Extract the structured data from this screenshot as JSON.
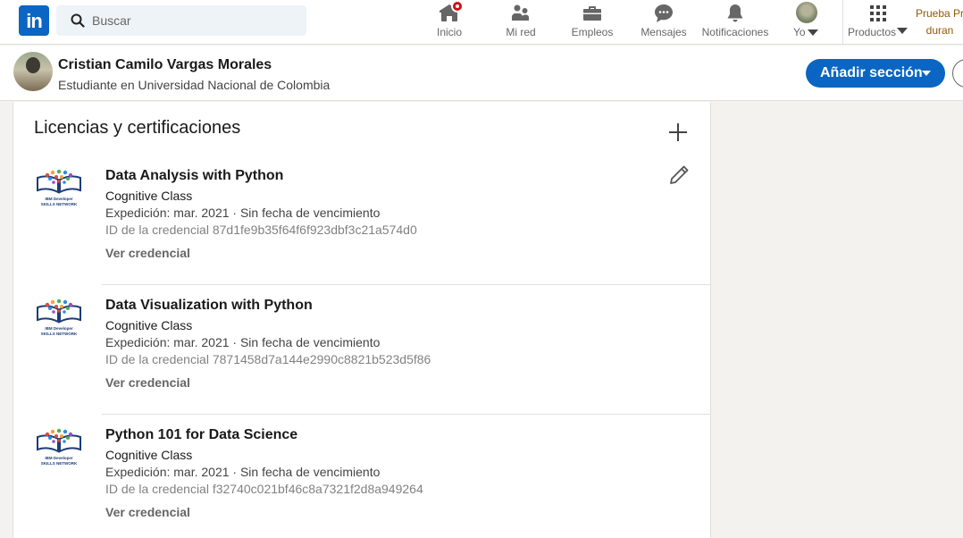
{
  "nav": {
    "logo": "in",
    "search_placeholder": "Buscar",
    "items": [
      {
        "label": "Inicio",
        "icon": "home-icon"
      },
      {
        "label": "Mi red",
        "icon": "network-icon"
      },
      {
        "label": "Empleos",
        "icon": "briefcase-icon"
      },
      {
        "label": "Mensajes",
        "icon": "messaging-icon"
      },
      {
        "label": "Notificaciones",
        "icon": "bell-icon"
      },
      {
        "label": "Yo",
        "icon": "avatar"
      },
      {
        "label": "Productos",
        "icon": "grid-icon"
      }
    ],
    "premium_line1": "Prueba Pr",
    "premium_line2": "duran"
  },
  "profile": {
    "name": "Cristian Camilo Vargas Morales",
    "headline": "Estudiante en Universidad Nacional de Colombia",
    "add_section_label": "Añadir sección"
  },
  "section": {
    "title": "Licencias y certificaciones",
    "certs": [
      {
        "title": "Data Analysis with Python",
        "issuer": "Cognitive Class",
        "date": "Expedición: mar. 2021 · Sin fecha de vencimiento",
        "credential_id": "ID de la credencial 87d1fe9b35f64f6f923dbf3c21a574d0",
        "link": "Ver credencial",
        "logo_text_1": "IBM Developer",
        "logo_text_2": "SKILLS NETWORK"
      },
      {
        "title": "Data Visualization with Python",
        "issuer": "Cognitive Class",
        "date": "Expedición: mar. 2021 · Sin fecha de vencimiento",
        "credential_id": "ID de la credencial 7871458d7a144e2990c8821b523d5f86",
        "link": "Ver credencial",
        "logo_text_1": "IBM Developer",
        "logo_text_2": "SKILLS NETWORK"
      },
      {
        "title": "Python 101 for Data Science",
        "issuer": "Cognitive Class",
        "date": "Expedición: mar. 2021 · Sin fecha de vencimiento",
        "credential_id": "ID de la credencial f32740c021bf46c8a7321f2d8a949264",
        "link": "Ver credencial",
        "logo_text_1": "IBM Developer",
        "logo_text_2": "SKILLS NETWORK"
      }
    ]
  },
  "colors": {
    "brand": "#0a66c2",
    "notification": "#cc1016",
    "premium": "#915907"
  }
}
